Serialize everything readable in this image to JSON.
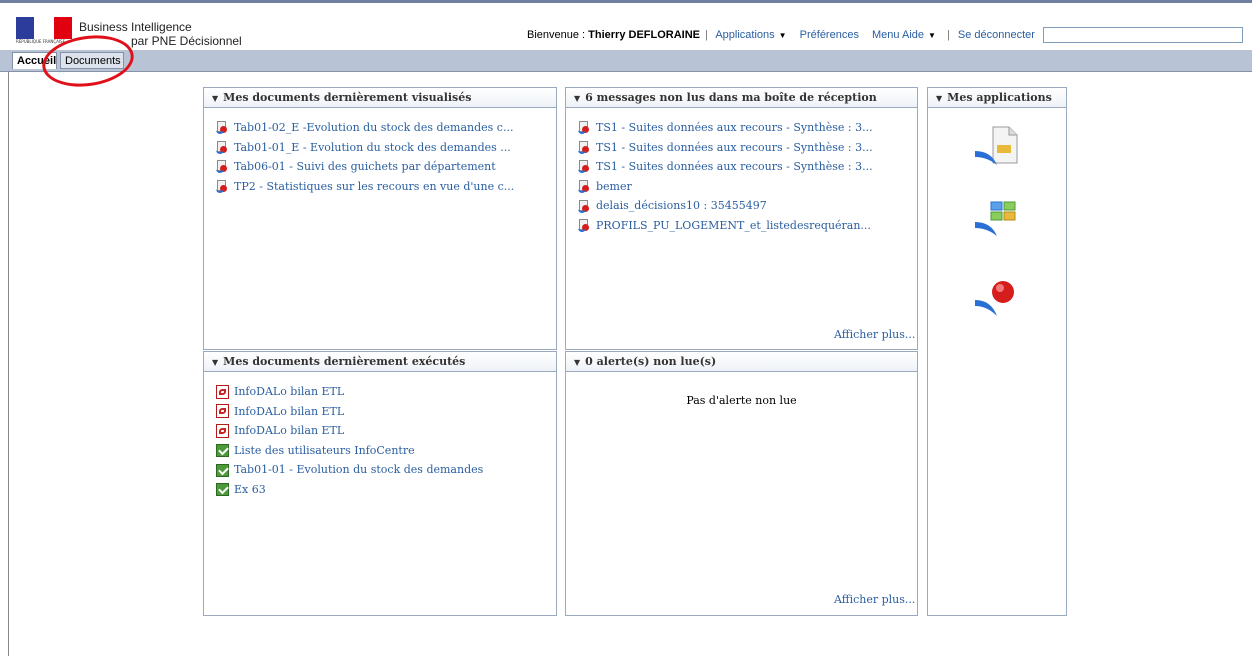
{
  "header": {
    "logo_text": "RÉPUBLIQUE FRANÇAISE",
    "title": "Business Intelligence",
    "subtitle": "par PNE Décisionnel",
    "welcome_label": "Bienvenue : ",
    "user_name": "Thierry DEFLORAINE",
    "menu_applications": "Applications",
    "menu_preferences": "Préférences",
    "menu_help": "Menu Aide",
    "menu_logout": "Se déconnecter",
    "search_value": ""
  },
  "tabs": [
    {
      "label": "Accueil",
      "active": true
    },
    {
      "label": "Documents",
      "active": false
    }
  ],
  "panels": {
    "recent_viewed": {
      "title": "Mes documents dernièrement visualisés",
      "items": [
        "Tab01-02_E -Evolution du stock des demandes c...",
        "Tab01-01_E - Evolution du stock des demandes ...",
        "Tab06-01 - Suivi des guichets par département",
        "TP2 - Statistiques sur les recours en vue d'une c..."
      ]
    },
    "inbox": {
      "title": "6 messages non lus dans ma boîte de réception",
      "items": [
        "TS1 - Suites données aux recours - Synthèse : 3...",
        "TS1 - Suites données aux recours - Synthèse : 3...",
        "TS1 - Suites données aux recours - Synthèse : 3...",
        "bemer",
        "delais_décisions10 : 35455497",
        "PROFILS_PU_LOGEMENT_et_listedesrequéran..."
      ],
      "more": "Afficher plus..."
    },
    "applications": {
      "title": "Mes applications",
      "icons": [
        "document-app-icon",
        "dashboard-app-icon",
        "analytics-app-icon"
      ]
    },
    "recent_executed": {
      "title": "Mes documents dernièrement exécutés",
      "items": [
        {
          "label": "InfoDALo bilan ETL",
          "type": "pdf"
        },
        {
          "label": "InfoDALo bilan ETL",
          "type": "pdf"
        },
        {
          "label": "InfoDALo bilan ETL",
          "type": "pdf"
        },
        {
          "label": "Liste des utilisateurs InfoCentre",
          "type": "xls"
        },
        {
          "label": "Tab01-01 - Evolution du stock des demandes",
          "type": "xls"
        },
        {
          "label": "Ex 63",
          "type": "xls"
        }
      ]
    },
    "alerts": {
      "title": "0 alerte(s) non lue(s)",
      "empty_text": "Pas d'alerte non lue",
      "more": "Afficher plus..."
    }
  },
  "colors": {
    "link": "#2a5ea0",
    "annotation": "#e0101b",
    "tabbar": "#b8c4d6"
  }
}
